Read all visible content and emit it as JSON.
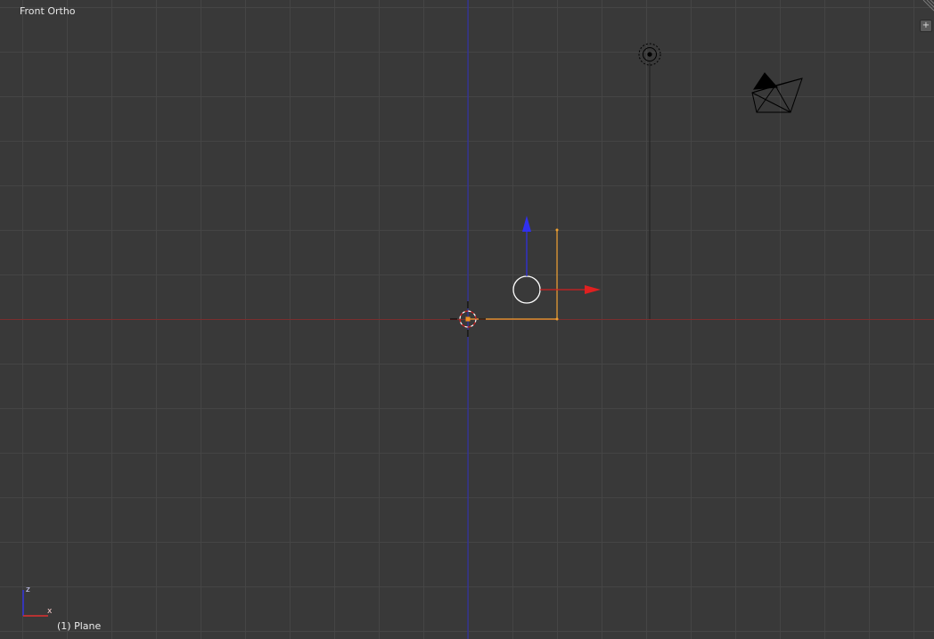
{
  "viewport": {
    "view_label": "Front Ortho",
    "object_label": "(1) Plane",
    "region_toggle_glyph": "+"
  },
  "axis_widget": {
    "z_label": "z",
    "x_label": "x"
  },
  "colors": {
    "background": "#393939",
    "grid_line": "#464646",
    "z_axis": "#2020c0",
    "x_axis": "#b02828",
    "selection": "#f0a030",
    "manipulator_z": "#3030f0",
    "manipulator_x": "#e02020"
  },
  "icons": {
    "lamp": "lamp-icon",
    "camera": "camera-icon",
    "cursor_3d": "3d-cursor-icon",
    "manipulator": "transform-manipulator-icon"
  }
}
